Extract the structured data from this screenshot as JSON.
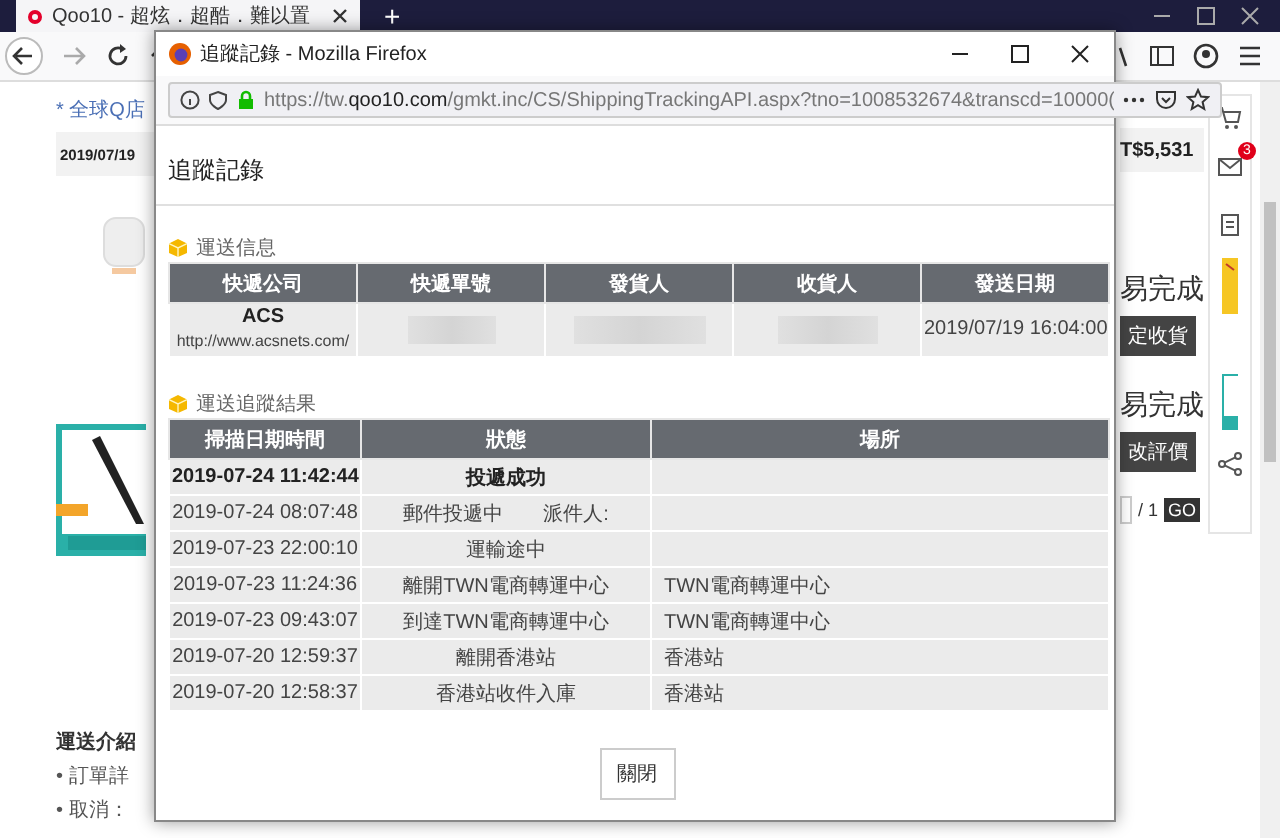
{
  "browser": {
    "tab_title": "Qoo10 - 超炫．超酷．難以置",
    "new_tab": "+"
  },
  "page": {
    "notice": "* 全球Q店",
    "order_date": "2019/07/19",
    "total": "T$5,531",
    "status_1": "易完成",
    "button_1": "定收貨",
    "status_2": "易完成",
    "button_2": "改評價",
    "pager": "/ 1",
    "go": "GO",
    "badge": "3",
    "intro_title": "運送介紹",
    "intro_items": [
      "• 訂單詳",
      "• 取消："
    ]
  },
  "popup": {
    "title": "追蹤記錄 - Mozilla Firefox",
    "url_host": "https://tw.",
    "url_domain": "qoo10.com",
    "url_path": "/gmkt.inc/CS/ShippingTrackingAPI.aspx?tno=1008532674&transcd=10000(",
    "heading": "追蹤記錄",
    "shipping_info": {
      "title": "運送信息",
      "columns": [
        "快遞公司",
        "快遞單號",
        "發貨人",
        "收貨人",
        "發送日期"
      ],
      "row": {
        "company": "ACS",
        "company_url": "http://www.acsnets.com/",
        "send_date": "2019/07/19 16:04:00"
      }
    },
    "tracking": {
      "title": "運送追蹤結果",
      "columns": [
        "掃描日期時間",
        "狀態",
        "場所"
      ],
      "rows": [
        {
          "time": "2019-07-24 11:42:44",
          "status": "投遞成功",
          "latest": true
        },
        {
          "time": "2019-07-24 08:07:48",
          "status": "郵件投遞中　　派件人:",
          "latest": false
        },
        {
          "time": "2019-07-23 22:00:10",
          "status": "運輸途中",
          "latest": false
        },
        {
          "time": "2019-07-23 11:24:36",
          "status": "離開TWN電商轉運中心",
          "place": "TWN電商轉運中心",
          "latest": false
        },
        {
          "time": "2019-07-23 09:43:07",
          "status": "到達TWN電商轉運中心",
          "place": "TWN電商轉運中心",
          "latest": false
        },
        {
          "time": "2019-07-20 12:59:37",
          "status": "離開香港站",
          "place": "香港站",
          "latest": false
        },
        {
          "time": "2019-07-20 12:58:37",
          "status": "香港站收件入庫",
          "place": "香港站",
          "latest": false
        }
      ]
    },
    "close_button": "關閉"
  }
}
